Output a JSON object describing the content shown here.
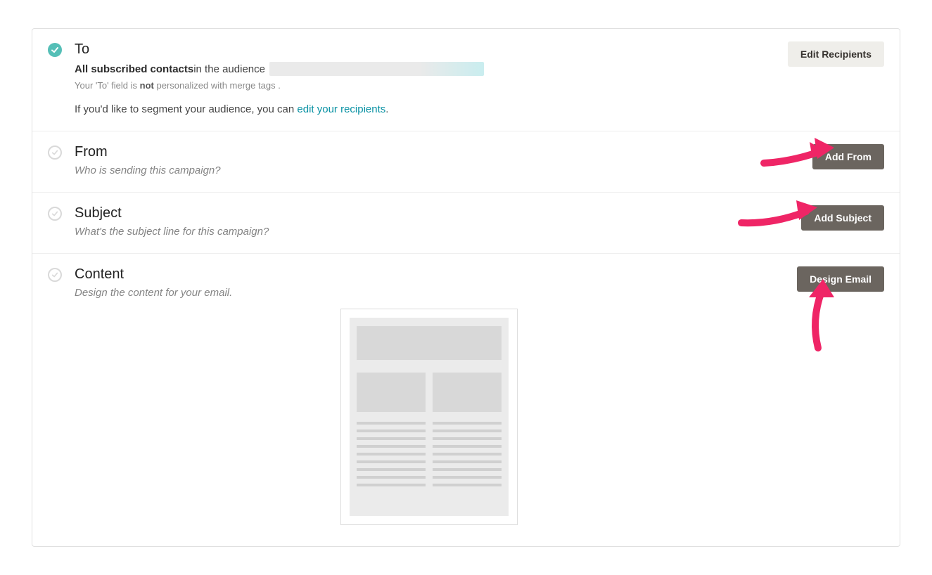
{
  "to": {
    "title": "To",
    "summary_bold": "All subscribed contacts",
    "summary_rest": " in the audience ",
    "note_prefix": "Your 'To' field is ",
    "note_strong": "not",
    "note_suffix": " personalized with merge tags .",
    "segment_prefix": "If you'd like to segment your audience, you can ",
    "segment_link": "edit your recipients",
    "segment_suffix": ".",
    "button": "Edit Recipients"
  },
  "from": {
    "title": "From",
    "hint": "Who is sending this campaign?",
    "button": "Add From"
  },
  "subject": {
    "title": "Subject",
    "hint": "What's the subject line for this campaign?",
    "button": "Add Subject"
  },
  "content": {
    "title": "Content",
    "hint": "Design the content for your email.",
    "button": "Design Email"
  },
  "colors": {
    "accent_teal": "#55bfb7",
    "annotation_pink": "#ef2566"
  }
}
